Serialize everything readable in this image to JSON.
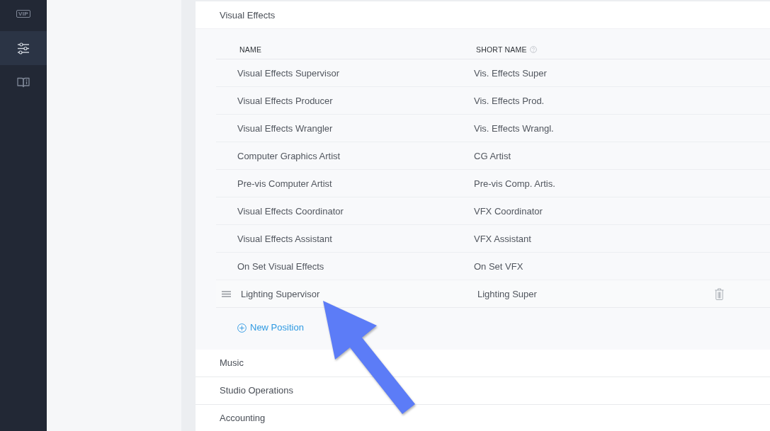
{
  "sidebar": {
    "items": [
      {
        "kind": "badge",
        "label": "VIP",
        "selected": false
      },
      {
        "kind": "sliders",
        "selected": true
      },
      {
        "kind": "guide",
        "selected": false
      }
    ]
  },
  "departments": [
    {
      "name": "Visual Effects",
      "expanded": true,
      "columns": [
        {
          "label": "NAME",
          "help": false
        },
        {
          "label": "SHORT NAME",
          "help": true
        }
      ],
      "positions": [
        {
          "name": "Visual Effects Supervisor",
          "short_name": "Vis. Effects Super",
          "dragging": false
        },
        {
          "name": "Visual Effects Producer",
          "short_name": "Vis. Effects Prod.",
          "dragging": false
        },
        {
          "name": "Visual Effects Wrangler",
          "short_name": "Vis. Effects Wrangl.",
          "dragging": false
        },
        {
          "name": "Computer Graphics Artist",
          "short_name": "CG Artist",
          "dragging": false
        },
        {
          "name": "Pre-vis Computer Artist",
          "short_name": "Pre-vis Comp. Artis.",
          "dragging": false
        },
        {
          "name": "Visual Effects Coordinator",
          "short_name": "VFX Coordinator",
          "dragging": false
        },
        {
          "name": "Visual Effects Assistant",
          "short_name": "VFX Assistant",
          "dragging": false
        },
        {
          "name": "On Set Visual Effects",
          "short_name": "On Set VFX",
          "dragging": false
        },
        {
          "name": "Lighting Supervisor",
          "short_name": "Lighting Super",
          "dragging": true
        }
      ],
      "add_action": "New Position"
    },
    {
      "name": "Music",
      "expanded": false
    },
    {
      "name": "Studio Operations",
      "expanded": false
    },
    {
      "name": "Accounting",
      "expanded": false
    }
  ],
  "annotations": [
    {
      "kind": "arrow"
    }
  ]
}
